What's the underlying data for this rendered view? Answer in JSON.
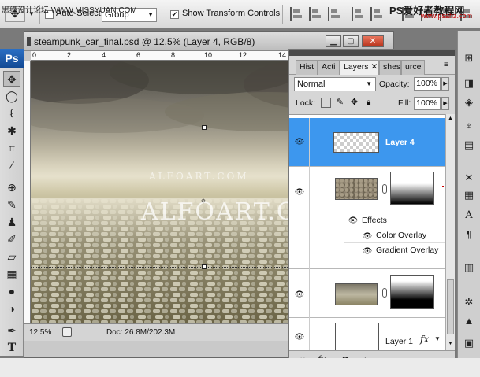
{
  "options_bar": {
    "tool_icon": "move-tool-icon",
    "auto_select_label": "Auto-Select:",
    "auto_select_checked": false,
    "auto_select_value": "Group",
    "show_transform_label": "Show Transform Controls",
    "show_transform_checked": true
  },
  "document": {
    "title": "steampunk_car_final.psd @ 12.5% (Layer 4, RGB/8)",
    "watermark_small": "ALFOART.COM",
    "watermark_large": "ALFOART.COM",
    "ruler_marks": [
      "0",
      "2",
      "4",
      "6",
      "8",
      "10",
      "12",
      "14"
    ],
    "status_zoom": "12.5%",
    "status_doc": "Doc: 26.8M/202.3M"
  },
  "toolbox": {
    "logo": "Ps",
    "tools": [
      "move-icon",
      "marquee-icon",
      "lasso-icon",
      "magic-wand-icon",
      "crop-icon",
      "eyedropper-icon",
      "healing-icon",
      "brush-icon",
      "stamp-icon",
      "history-brush-icon",
      "eraser-icon",
      "gradient-icon",
      "blur-icon",
      "dodge-icon",
      "pen-icon",
      "type-icon"
    ]
  },
  "layers_panel": {
    "tabs": [
      "Hist",
      "Acti",
      "Layers",
      "shes",
      "urce"
    ],
    "active_tab": "Layers",
    "blend_mode": "Normal",
    "opacity_label": "Opacity:",
    "opacity_value": "100%",
    "lock_label": "Lock:",
    "fill_label": "Fill:",
    "fill_value": "100%",
    "layers": [
      {
        "name": "Layer 4",
        "selected": true
      },
      {
        "name": "",
        "selected": false
      },
      {
        "name": "Layer 1",
        "selected": false
      }
    ],
    "effects_label": "Effects",
    "effects": [
      "Color Overlay",
      "Gradient Overlay"
    ],
    "fx_label": "fx"
  },
  "credits": {
    "left": "思缘设计论坛 WWW.MISSYUAN.COM",
    "right": "PS爱好者教程网",
    "right_url": "www.psahz.com"
  }
}
